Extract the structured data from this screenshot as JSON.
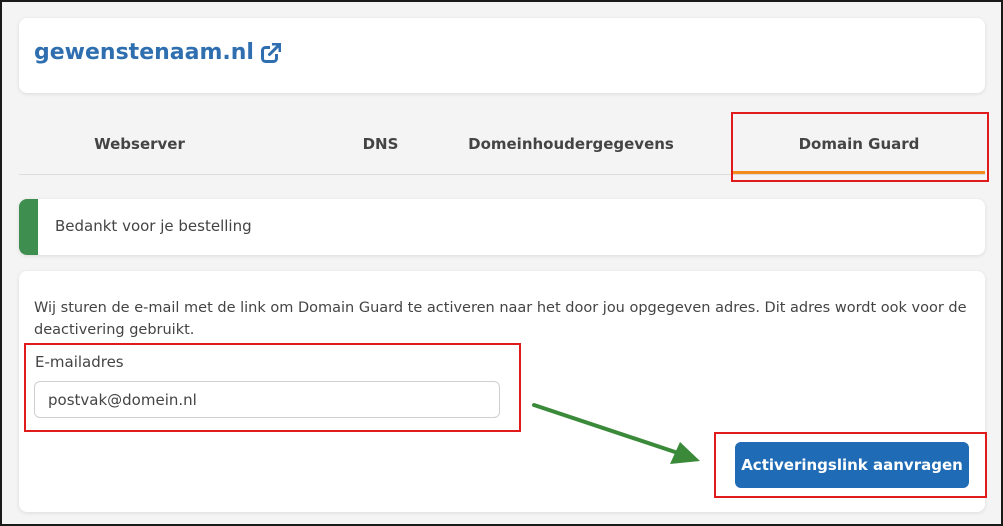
{
  "header": {
    "domain_name": "gewenstenaam.nl",
    "external_link_icon": "external-link-icon"
  },
  "tabs": [
    {
      "label": "Webserver",
      "active": false
    },
    {
      "label": "DNS",
      "active": false
    },
    {
      "label": "Domeinhoudergegevens",
      "active": false
    },
    {
      "label": "Domain Guard",
      "active": true
    }
  ],
  "alert": {
    "message": "Bedankt voor je bestelling",
    "status_color": "#3e8e4f"
  },
  "form": {
    "intro": "Wij sturen de e-mail met de link om Domain Guard te activeren naar het door jou opgegeven adres. Dit adres wordt ook voor de deactivering gebruikt.",
    "email_label": "E-mailadres",
    "email_value": "postvak@domein.nl",
    "submit_label": "Activeringslink aanvragen"
  },
  "colors": {
    "link": "#2f6fb0",
    "tab_active_underline": "#f28c1a",
    "button": "#1f6bb5",
    "highlight": "#e01b1b",
    "arrow": "#3a8a3a"
  }
}
